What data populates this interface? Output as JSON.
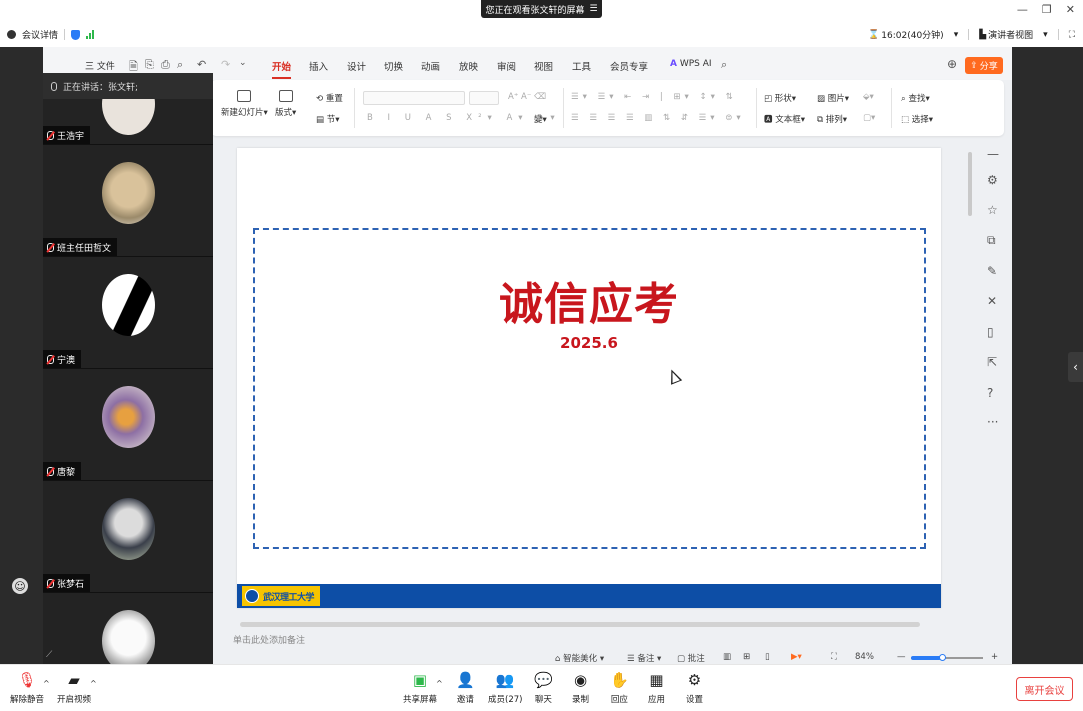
{
  "topbar": {
    "share_banner": "您正在观看张文轩的屏幕",
    "meeting_details": "会议详情",
    "time": "16:02(40分钟)",
    "presenter_view": "演讲者视图"
  },
  "left_panel": {
    "speaking_label": "正在讲话：张文轩;",
    "participants": [
      {
        "name": "王浩宇"
      },
      {
        "name": "班主任田哲文"
      },
      {
        "name": "宁澳"
      },
      {
        "name": "唐黎"
      },
      {
        "name": "张梦石"
      }
    ]
  },
  "wps": {
    "file_menu": "三 文件",
    "tabs": [
      "开始",
      "插入",
      "设计",
      "切换",
      "动画",
      "放映",
      "审阅",
      "视图",
      "工具",
      "会员专享"
    ],
    "active_tab": "开始",
    "wps_ai": "WPS AI",
    "share_button": "分享",
    "ribbon": {
      "new_slide": "新建幻灯片",
      "layout": "版式",
      "reset": "重置",
      "section": "节",
      "shape": "形状",
      "picture": "图片",
      "textbox": "文本框",
      "arrange": "排列",
      "find": "查找",
      "select": "选择"
    },
    "slide": {
      "title": "诚信应考",
      "date": "2025.6",
      "logo_text": "武汉理工大学",
      "brand_color": "#c8161d",
      "footer_color": "#0d4ea6"
    },
    "notes_placeholder": "单击此处添加备注",
    "status": {
      "smart_beautify": "智能美化",
      "notes": "备注",
      "comments": "批注",
      "zoom": "84%"
    }
  },
  "bottombar": {
    "unmute": "解除静音",
    "start_video": "开启视频",
    "share_screen": "共享屏幕",
    "invite": "邀请",
    "members": "成员(27)",
    "chat": "聊天",
    "record": "录制",
    "reactions": "回应",
    "apps": "应用",
    "settings": "设置",
    "leave": "离开会议"
  }
}
